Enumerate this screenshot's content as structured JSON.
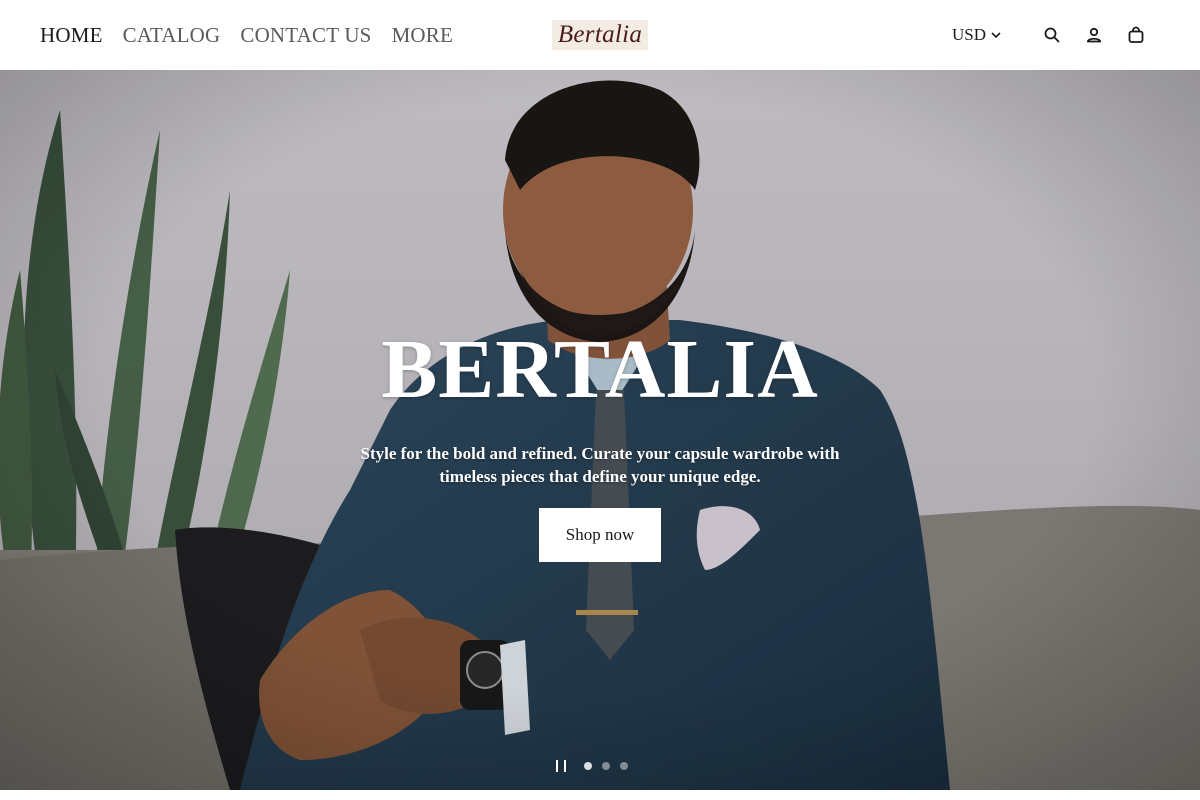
{
  "header": {
    "nav": [
      {
        "label": "HOME",
        "active": true
      },
      {
        "label": "CATALOG",
        "active": false
      },
      {
        "label": "CONTACT US",
        "active": false
      },
      {
        "label": "MORE",
        "active": false
      }
    ],
    "logo": "Bertalia",
    "currency": "USD",
    "icons": [
      "search-icon",
      "account-icon",
      "cart-icon"
    ]
  },
  "hero": {
    "title": "BERTALIA",
    "subtitle": "Style for the bold and refined. Curate your capsule wardrobe with timeless pieces that define your unique edge.",
    "cta": "Shop now",
    "slides": 3,
    "active_slide": 1
  },
  "colors": {
    "logo_bg": "#f3ece4",
    "logo_text": "#4a1c1c",
    "hero_text": "#ffffff",
    "button_bg": "#ffffff"
  }
}
